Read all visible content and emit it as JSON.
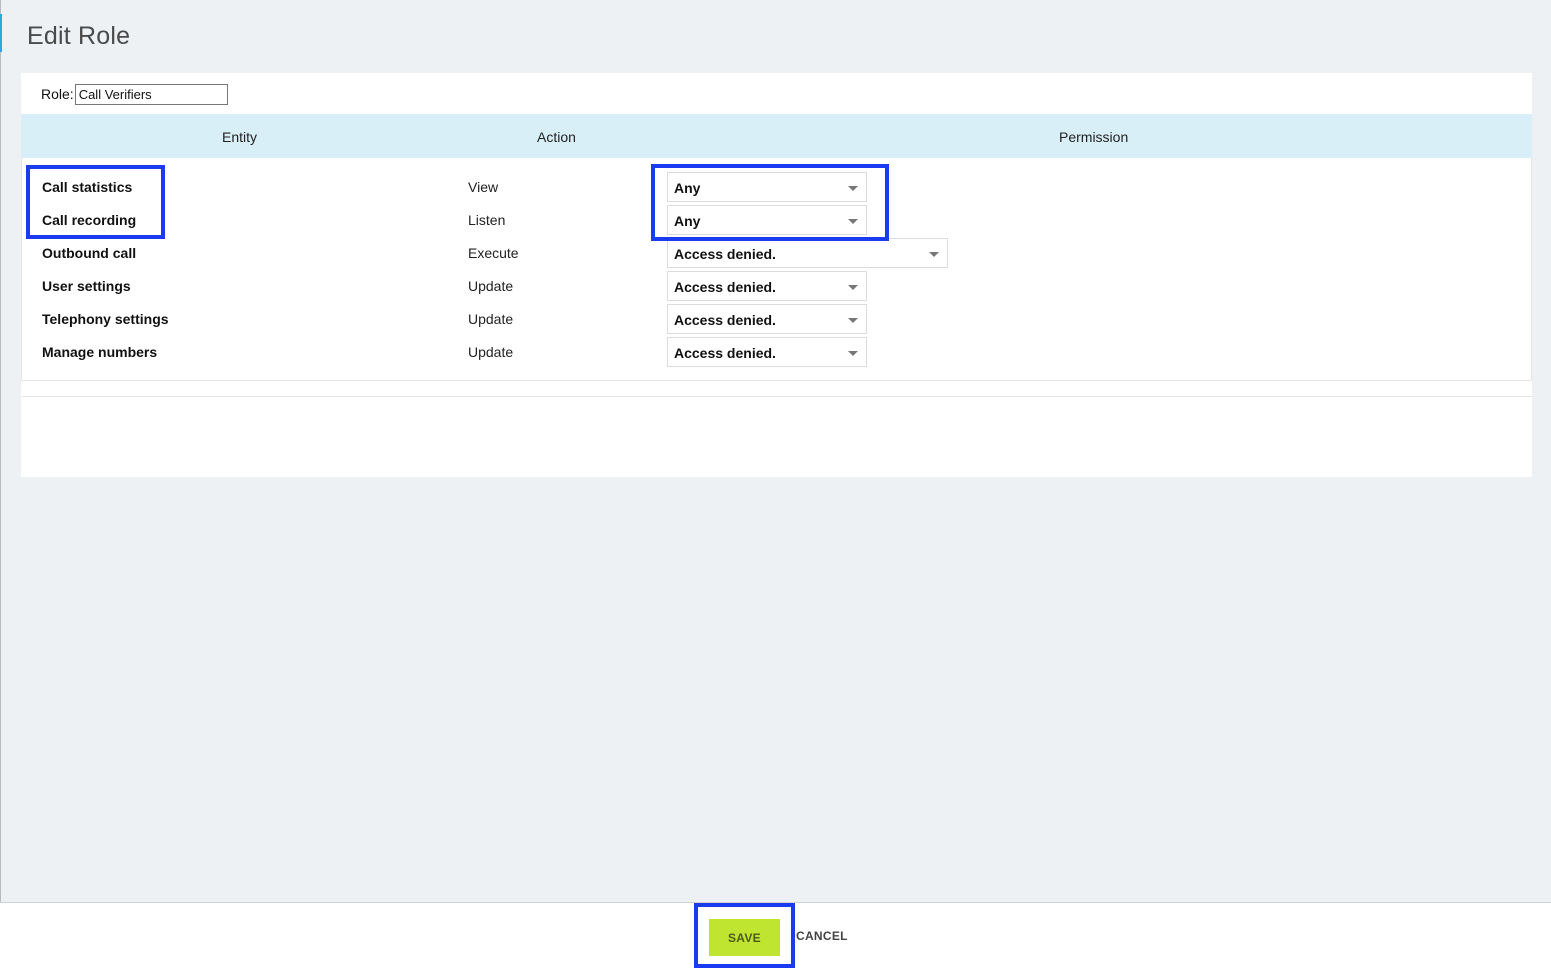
{
  "page": {
    "title": "Edit Role"
  },
  "role": {
    "label": "Role:",
    "value": "Call Verifiers"
  },
  "table": {
    "headers": {
      "entity": "Entity",
      "action": "Action",
      "permission": "Permission"
    },
    "rows": [
      {
        "entity": "Call statistics",
        "action": "View",
        "permission": "Any"
      },
      {
        "entity": "Call recording",
        "action": "Listen",
        "permission": "Any"
      },
      {
        "entity": "Outbound call",
        "action": "Execute",
        "permission": "Access denied."
      },
      {
        "entity": "User settings",
        "action": "Update",
        "permission": "Access denied."
      },
      {
        "entity": "Telephony settings",
        "action": "Update",
        "permission": "Access denied."
      },
      {
        "entity": "Manage numbers",
        "action": "Update",
        "permission": "Access denied."
      }
    ]
  },
  "footer": {
    "save_label": "SAVE",
    "cancel_label": "CANCEL"
  },
  "colors": {
    "highlight": "#1a3bf0",
    "save_button": "#bfe531",
    "header_band": "#d9eff8",
    "background": "#edf1f4"
  }
}
